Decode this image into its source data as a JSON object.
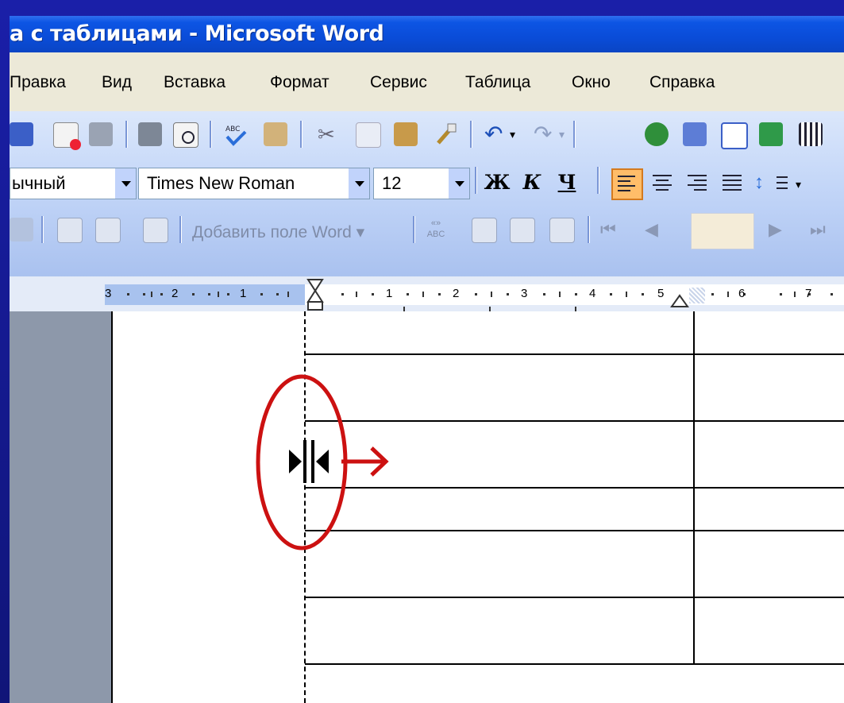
{
  "window": {
    "title": "а с таблицами - Microsoft Word"
  },
  "menu": [
    "Правка",
    "Вид",
    "Вставка",
    "Формат",
    "Сервис",
    "Таблица",
    "Окно",
    "Справка"
  ],
  "formatting": {
    "style": "ычный",
    "font": "Times New Roman",
    "size": "12",
    "bold": "Ж",
    "italic": "К",
    "underline": "Ч"
  },
  "mailmerge": {
    "add_field": "Добавить поле Word ▾"
  },
  "ruler": {
    "labels": [
      "3",
      "2",
      "1",
      "1",
      "2",
      "3",
      "4",
      "5",
      "6",
      "7"
    ]
  },
  "colors": {
    "annotation": "#cc1111",
    "title_bar": "#0a4cd8",
    "toolbar": "#c3d6f8"
  },
  "annotation": {
    "shape": "ellipse",
    "cursor": "column-resize-cursor",
    "arrow": "right"
  }
}
